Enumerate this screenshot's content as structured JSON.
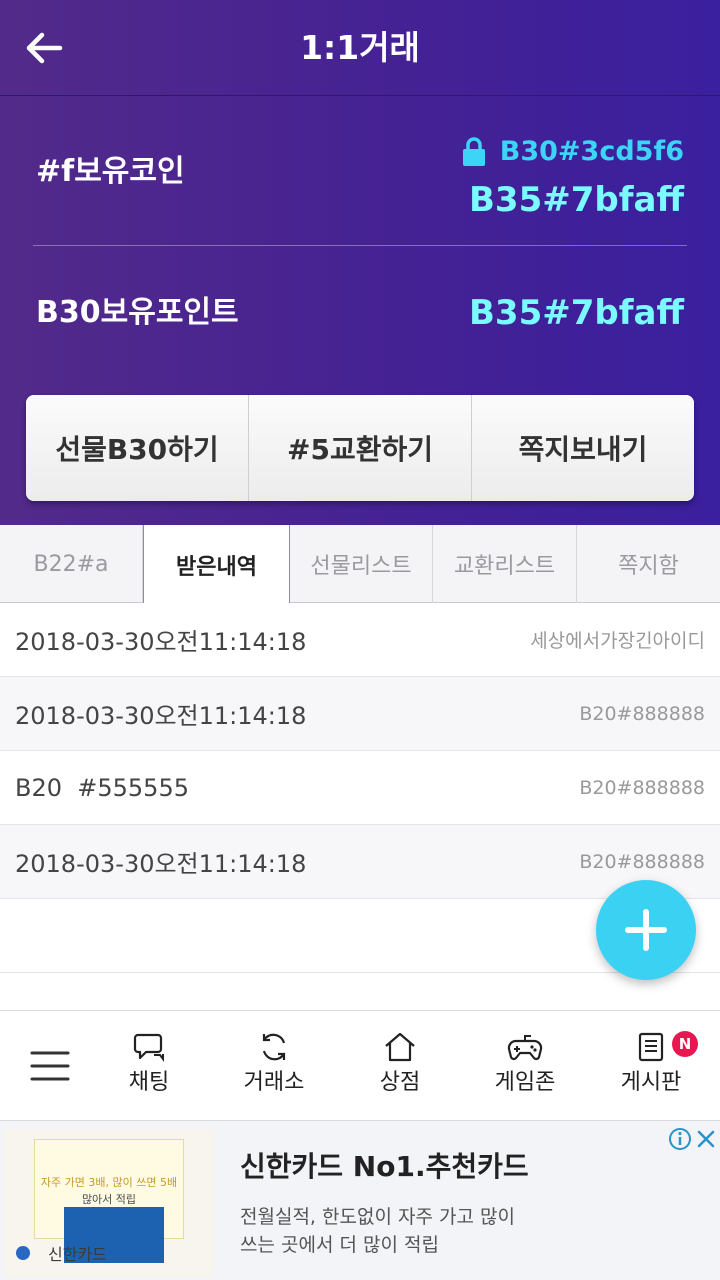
{
  "header": {
    "title": "1:1거래",
    "back_icon": "arrow-left-icon"
  },
  "summary": {
    "coin_label": "#f보유코인",
    "coin_locked_value": "B30#3cd5f6",
    "coin_value": "B35#7bfaff",
    "point_label": "B30보유포인트",
    "point_value": "B35#7bfaff",
    "lock_icon": "lock-icon",
    "colors": {
      "locked": "#3cd5f6",
      "value": "#7bfaff"
    }
  },
  "actions": {
    "gift": "선물B30하기",
    "exchange": "#5교환하기",
    "message": "쪽지보내기"
  },
  "tabs": [
    {
      "label": "B22#a",
      "active": false
    },
    {
      "label": "받은내역",
      "active": true
    },
    {
      "label": "선물리스트",
      "active": false
    },
    {
      "label": "교환리스트",
      "active": false
    },
    {
      "label": "쪽지함",
      "active": false
    }
  ],
  "rows": [
    {
      "main": "2018-03-30오전11:14:18",
      "side": "세상에서가장긴아이디"
    },
    {
      "main": "2018-03-30오전11:14:18",
      "side": "B20#888888"
    },
    {
      "main": "B20  #555555",
      "side": "B20#888888"
    },
    {
      "main": "2018-03-30오전11:14:18",
      "side": "B20#888888"
    },
    {
      "main": "",
      "side": ""
    }
  ],
  "fab": {
    "icon": "plus-icon",
    "color": "#3bd1f3"
  },
  "bottom_nav": {
    "menu_icon": "hamburger-menu-icon",
    "items": [
      {
        "label": "채팅",
        "icon": "chat-icon"
      },
      {
        "label": "거래소",
        "icon": "refresh-icon"
      },
      {
        "label": "상점",
        "icon": "home-icon"
      },
      {
        "label": "게임존",
        "icon": "gamepad-icon"
      },
      {
        "label": "게시판",
        "icon": "board-icon",
        "badge": "N"
      }
    ]
  },
  "ad": {
    "title": "신한카드 No1.추천카드",
    "desc_line1": "전월실적, 한도없이 자주 가고 많이",
    "desc_line2": "쓰는 곳에서 더 많이 적립",
    "thumb_line1": "자주 가면 3배, 많이 쓰면 5배",
    "thumb_line2": "많아서 적립",
    "brand": "신한카드"
  }
}
